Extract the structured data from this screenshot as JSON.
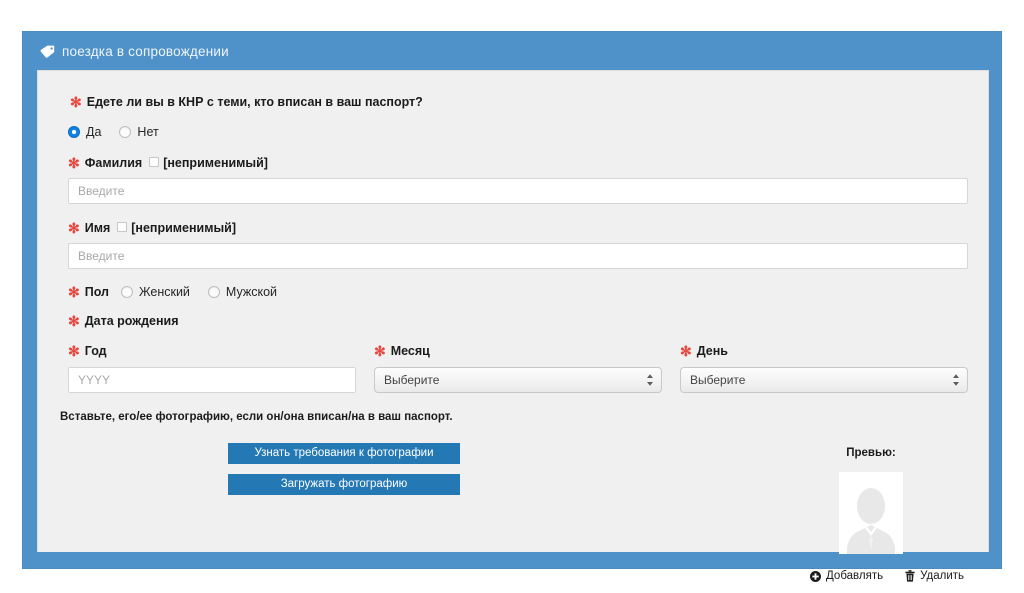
{
  "panel": {
    "header_title": "поездка в сопровождении",
    "header_icon": "tag-icon",
    "header_bg": "#4e92c9",
    "body_bg": "#f0f0f0"
  },
  "form": {
    "required_marker": "✻",
    "question": "Едете ли вы в КНР с теми, кто вписан в ваш паспорт?",
    "yes_no": [
      {
        "label": "Да",
        "selected": true
      },
      {
        "label": "Нет",
        "selected": false
      }
    ],
    "surname": {
      "label": "Фамилия",
      "na_label": "[неприменимый]",
      "na_checked": false,
      "placeholder": "Введите",
      "value": ""
    },
    "firstname": {
      "label": "Имя",
      "na_label": "[неприменимый]",
      "na_checked": false,
      "placeholder": "Введите",
      "value": ""
    },
    "gender": {
      "label": "Пол",
      "options": [
        {
          "label": "Женский",
          "selected": false
        },
        {
          "label": "Мужской",
          "selected": false
        }
      ]
    },
    "dob": {
      "label": "Дата рождения",
      "year": {
        "label": "Год",
        "placeholder": "YYYY",
        "value": ""
      },
      "month": {
        "label": "Месяц",
        "selected": "Выберите"
      },
      "day": {
        "label": "День",
        "selected": "Выберите"
      }
    },
    "photo": {
      "note": "Вставьте, его/ее фотографию, если он/она вписан/на в ваш паспорт.",
      "requirements_button": "Узнать требования к фотографии",
      "upload_button": "Загружать фотографию",
      "button_color": "#2479b4",
      "preview_title": "Превью:",
      "add_label": "Добавлять",
      "delete_label": "Удалить"
    }
  }
}
